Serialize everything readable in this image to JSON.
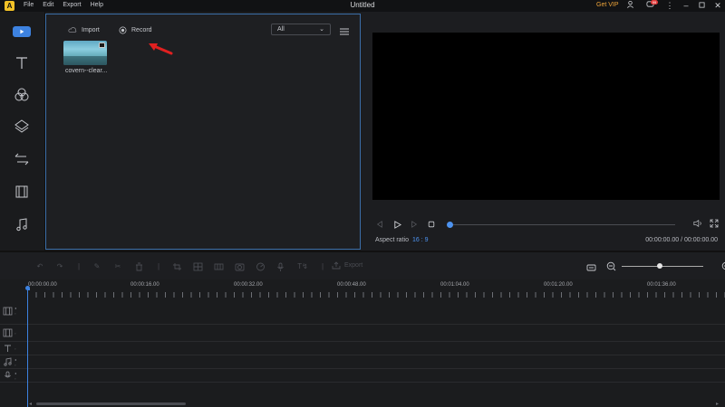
{
  "app": {
    "logo_letter": "A",
    "title": "Untitled",
    "menu": [
      "File",
      "Edit",
      "Export",
      "Help"
    ],
    "get_vip": "Get VIP",
    "notification_count": "99"
  },
  "media": {
    "import_label": "Import",
    "record_label": "Record",
    "filter_value": "All",
    "item_label": "covern--clear..."
  },
  "preview": {
    "aspect_label": "Aspect ratio",
    "aspect_value": "16 : 9",
    "time": "00:00:00.00 / 00:00:00.00"
  },
  "toolbar": {
    "export_label": "Export"
  },
  "timeline": {
    "ruler": [
      "00:00:00.00",
      "00:00:16.00",
      "00:00:32.00",
      "00:00:48.00",
      "00:01:04.00",
      "00:01:20.00",
      "00:01:36.00"
    ]
  },
  "colors": {
    "accent": "#3d82e0",
    "vip": "#f0a53a",
    "logo": "#f3c227"
  }
}
